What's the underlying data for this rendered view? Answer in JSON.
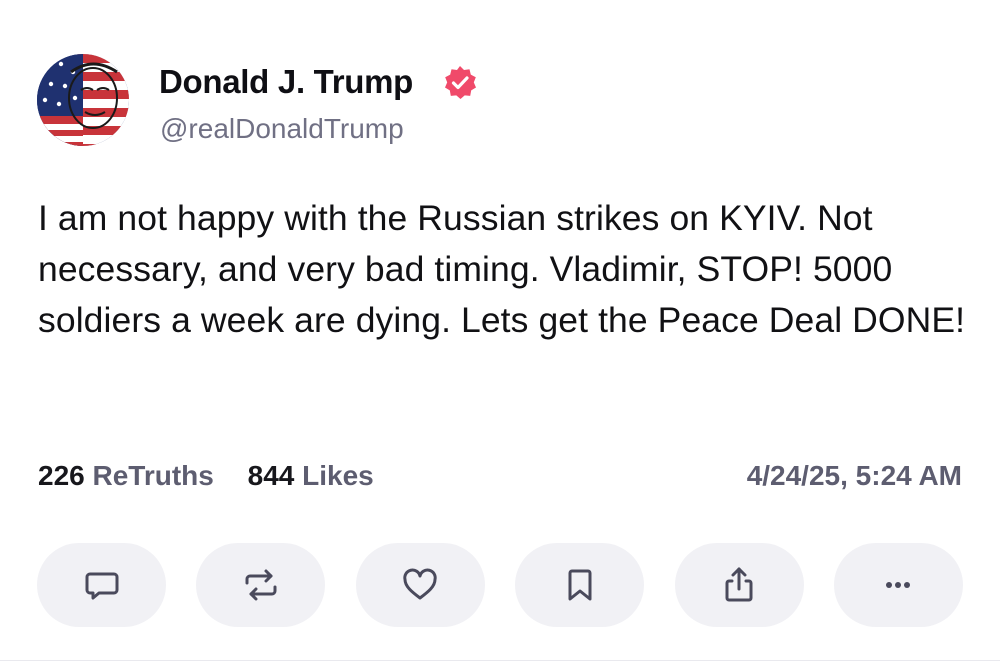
{
  "author": {
    "display_name": "Donald J. Trump",
    "handle": "@realDonaldTrump",
    "verified_color": "#f04a6a",
    "avatar_icon": "american-flag-face-avatar"
  },
  "post": {
    "text": "I am not happy with the Russian strikes on KYIV. Not necessary, and very bad timing. Vladimir, STOP! 5000 soldiers a week are dying. Lets get the Peace Deal DONE!"
  },
  "stats": {
    "retruths_count": "226",
    "retruths_label": "ReTruths",
    "likes_count": "844",
    "likes_label": "Likes",
    "timestamp": "4/24/25, 5:24 AM"
  },
  "actions": [
    {
      "name": "reply",
      "icon": "comment-icon"
    },
    {
      "name": "retruth",
      "icon": "repost-icon"
    },
    {
      "name": "like",
      "icon": "heart-icon"
    },
    {
      "name": "bookmark",
      "icon": "bookmark-icon"
    },
    {
      "name": "share",
      "icon": "share-icon"
    },
    {
      "name": "more",
      "icon": "more-icon"
    }
  ],
  "colors": {
    "button_bg": "#f1f1f5",
    "icon_color": "#4a4a5c",
    "secondary_text": "#707084"
  }
}
